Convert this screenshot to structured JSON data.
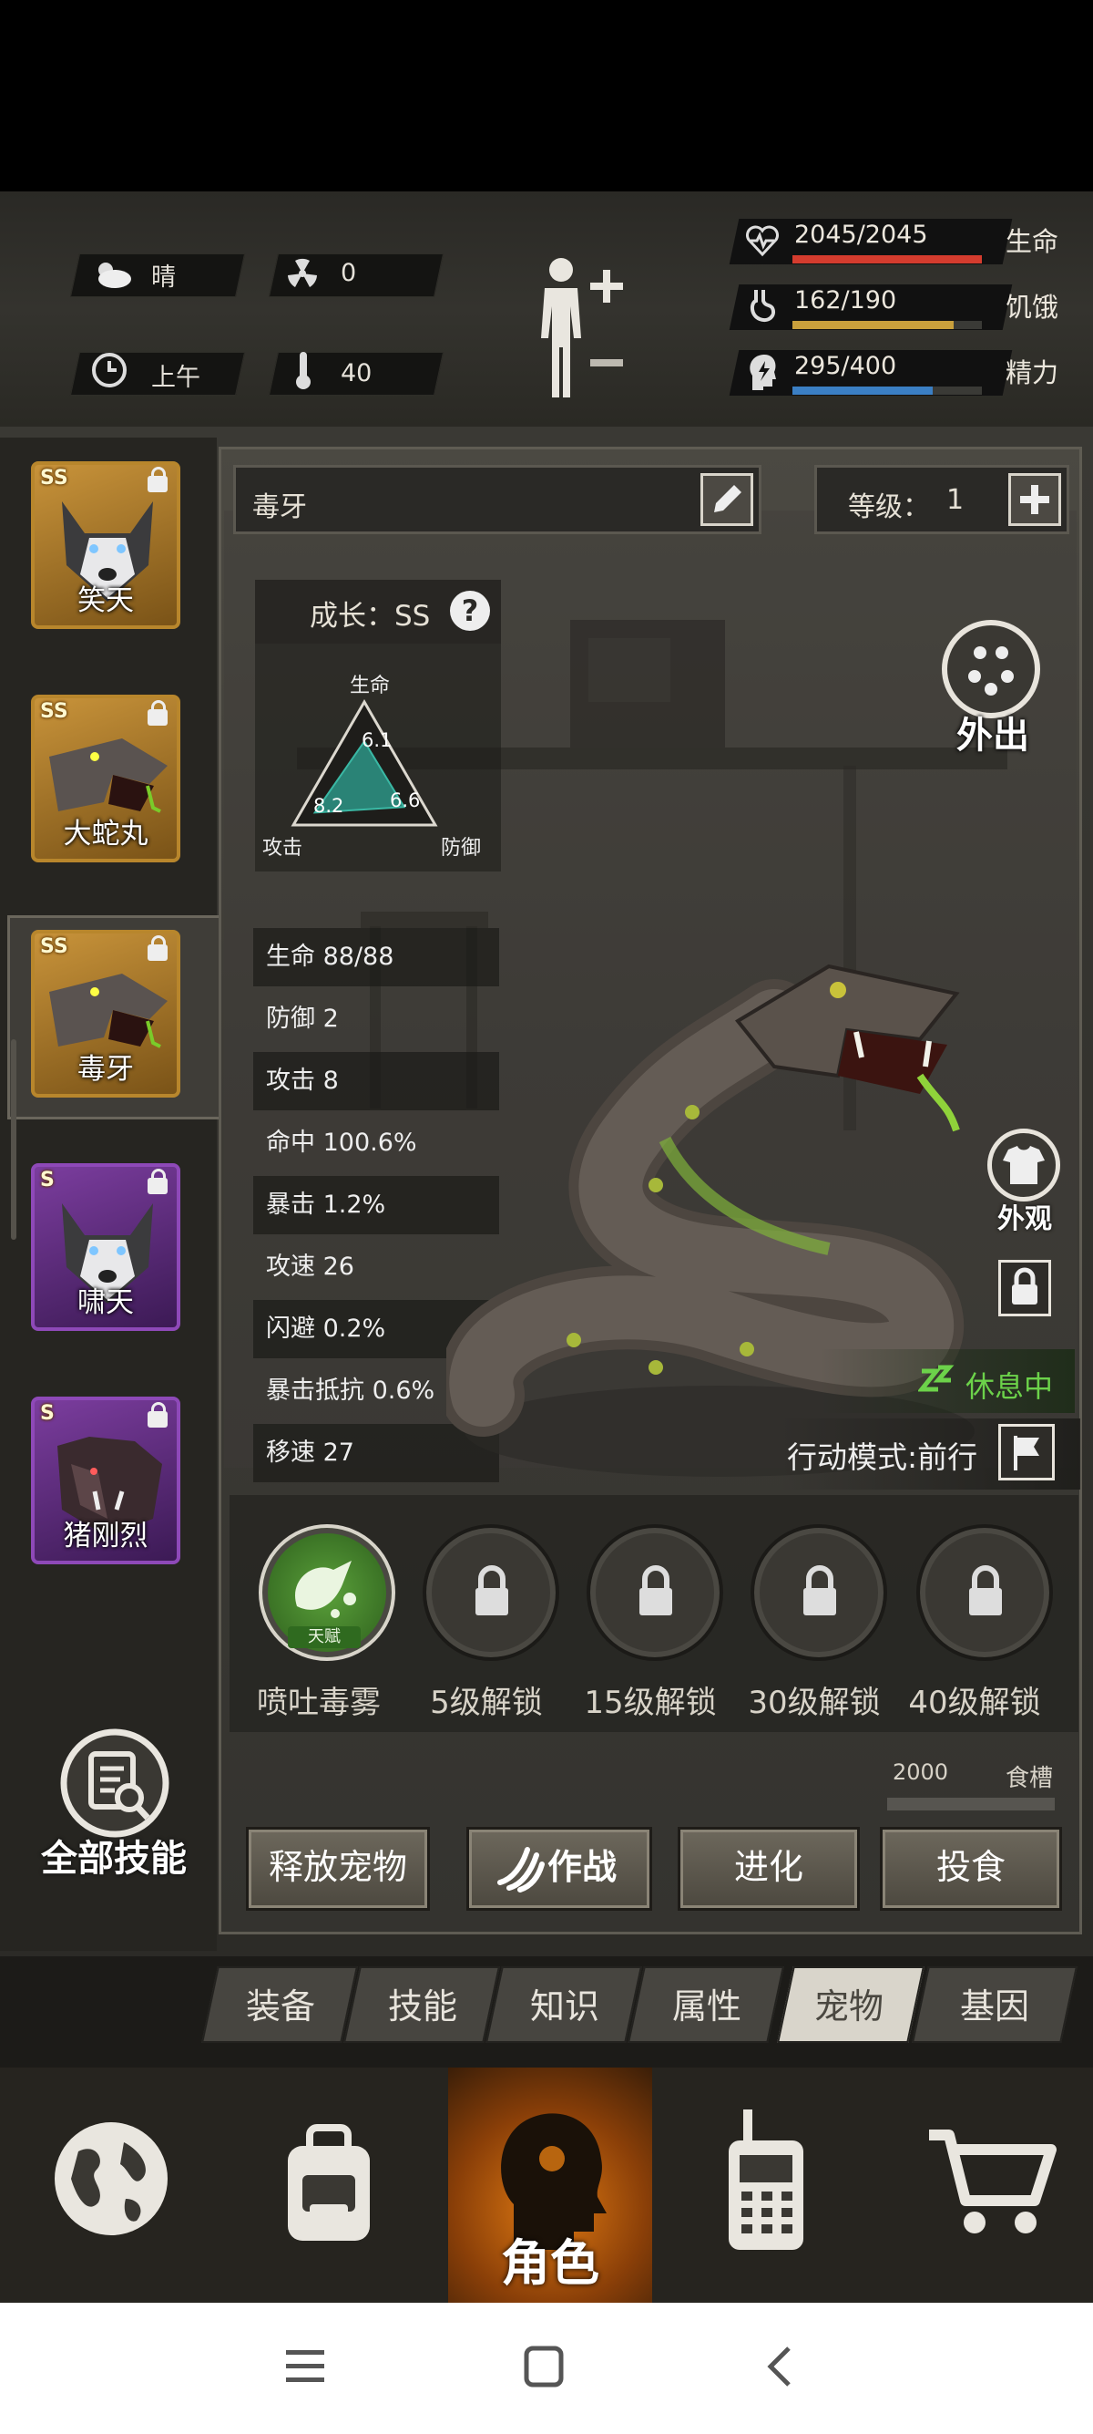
{
  "status": {
    "weather": "晴",
    "radiation": "0",
    "time": "上午",
    "temperature": "40",
    "hp": {
      "value": "2045/2045",
      "label": "生命",
      "fraction": 1.0,
      "color": "#d43c2e"
    },
    "hunger": {
      "value": "162/190",
      "label": "饥饿",
      "fraction": 0.85,
      "color": "#c9a03c"
    },
    "energy": {
      "value": "295/400",
      "label": "精力",
      "fraction": 0.74,
      "color": "#3b7fc4"
    }
  },
  "pets": [
    {
      "name": "笑天",
      "grade": "SS",
      "locked": true
    },
    {
      "name": "大蛇丸",
      "grade": "SS",
      "locked": true
    },
    {
      "name": "毒牙",
      "grade": "SS",
      "locked": true,
      "selected": true
    },
    {
      "name": "啸天",
      "grade": "S",
      "locked": true
    },
    {
      "name": "猪刚烈",
      "grade": "S",
      "locked": true
    }
  ],
  "all_skills_label": "全部技能",
  "pet": {
    "name": "毒牙",
    "level_label": "等级：",
    "level": "1",
    "growth_label": "成长：SS",
    "radar": {
      "axes": [
        "生命",
        "防御",
        "攻击"
      ],
      "values": [
        6.1,
        6.6,
        8.2
      ]
    },
    "stats": [
      "生命 88/88",
      "防御 2",
      "攻击 8",
      "命中 100.6%",
      "暴击 1.2%",
      "攻速 26",
      "闪避 0.2%",
      "暴击抵抗 0.6%",
      "移速 27"
    ],
    "out_label": "外出",
    "appearance_label": "外观",
    "status_label": "休息中",
    "mode_label": "行动模式:前行",
    "skills": [
      {
        "name": "喷吐毒雾",
        "tag": "天赋",
        "locked": false
      },
      {
        "name": "5级解锁",
        "locked": true
      },
      {
        "name": "15级解锁",
        "locked": true
      },
      {
        "name": "30级解锁",
        "locked": true
      },
      {
        "name": "40级解锁",
        "locked": true
      }
    ],
    "food_value": "2000",
    "food_label": "食槽",
    "food_fraction": 0.0
  },
  "actions": [
    "释放宠物",
    "作战",
    "进化",
    "投食"
  ],
  "tabs": [
    "装备",
    "技能",
    "知识",
    "属性",
    "宠物",
    "基因"
  ],
  "active_tab": "宠物",
  "bottom_nav": {
    "active_label": "角色"
  },
  "colors": {
    "accent_green": "#6cd24a",
    "card_gold": "#b8862c",
    "card_purple": "#8e49b8"
  }
}
